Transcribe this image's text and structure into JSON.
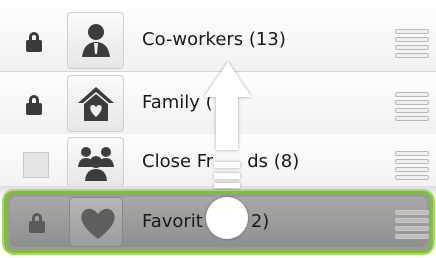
{
  "groups": [
    {
      "label": "Co-workers (13)",
      "icon": "coworker-person-icon",
      "locked": true
    },
    {
      "label": "Family (",
      "icon": "family-house-icon",
      "locked": true
    },
    {
      "label": "Close Fr​nds (8)",
      "icon": "close-friends-group-icon",
      "locked": false
    },
    {
      "label": "Favorit 2)",
      "icon": "heart-icon",
      "locked": true,
      "dragging": true
    }
  ],
  "labels_visible": {
    "row0": "Co-workers (13)",
    "row1": "Family (",
    "row2a": "Close Fr",
    "row2b": "ds (8)",
    "row3a": "Favorit",
    "row3b": "2)"
  },
  "colors": {
    "drag_highlight": "#7dc13b",
    "drag_background": "#9a9a9a",
    "lock": "#3a3a3a"
  },
  "gesture": {
    "direction": "up",
    "icon": "swipe-up-gesture-icon"
  }
}
